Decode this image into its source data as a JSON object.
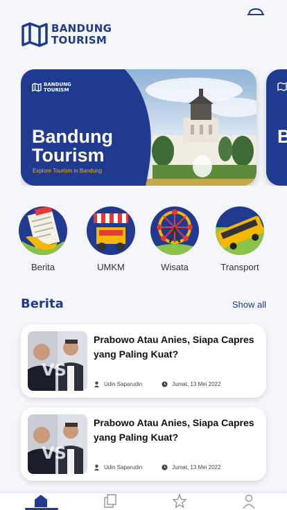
{
  "header": {
    "logo_line1": "BANDUNG",
    "logo_line2": "TOURISM",
    "bell_icon": "notification-icon"
  },
  "banner": {
    "logo_line1": "BANDUNG",
    "logo_line2": "TOURISM",
    "title_line1": "Bandung",
    "title_line2": "Tourism",
    "subtitle": "Explore Tourism in Bandung",
    "peek_letter": "B"
  },
  "categories": [
    {
      "label": "Berita",
      "icon": "newspaper-icon"
    },
    {
      "label": "UMKM",
      "icon": "food-cart-icon"
    },
    {
      "label": "Wisata",
      "icon": "ferris-wheel-icon"
    },
    {
      "label": "Transport",
      "icon": "bus-icon"
    }
  ],
  "section": {
    "title": "Berita",
    "show_all": "Show all"
  },
  "news": [
    {
      "headline": "Prabowo Atau Anies, Siapa Capres yang Paling Kuat?",
      "author": "Udin Saparudin",
      "date": "Jumat, 13 Mei 2022"
    },
    {
      "headline": "Prabowo Atau Anies, Siapa Capres yang Paling Kuat?",
      "author": "Udin Saparudin",
      "date": "Jumat, 13 Mei 2022"
    }
  ],
  "nav": [
    "home-icon",
    "copy-icon",
    "star-icon",
    "profile-icon"
  ],
  "colors": {
    "primary": "#1f3a8f",
    "accent": "#f5b800",
    "background": "#f4f6fb"
  }
}
